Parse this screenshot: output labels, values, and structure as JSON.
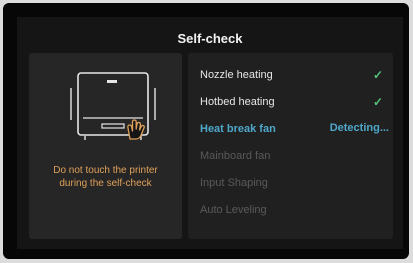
{
  "screen": {
    "title": "Self-check"
  },
  "warning": {
    "line1": "Do not touch the printer",
    "line2": "during the self-check",
    "icon": "printer-with-hand-icon",
    "color": "#e0a15a"
  },
  "checks": [
    {
      "label": "Nozzle heating",
      "status": "done",
      "status_icon": "checkmark-icon"
    },
    {
      "label": "Hotbed heating",
      "status": "done",
      "status_icon": "checkmark-icon"
    },
    {
      "label": "Heat break fan",
      "status": "active",
      "status_text": "Detecting..."
    },
    {
      "label": "Mainboard fan",
      "status": "pending"
    },
    {
      "label": "Input Shaping",
      "status": "pending"
    },
    {
      "label": "Auto Leveling",
      "status": "pending"
    }
  ],
  "colors": {
    "accent": "#4ea7c9",
    "success": "#55c07a",
    "pending_text": "#5a5a5a"
  }
}
